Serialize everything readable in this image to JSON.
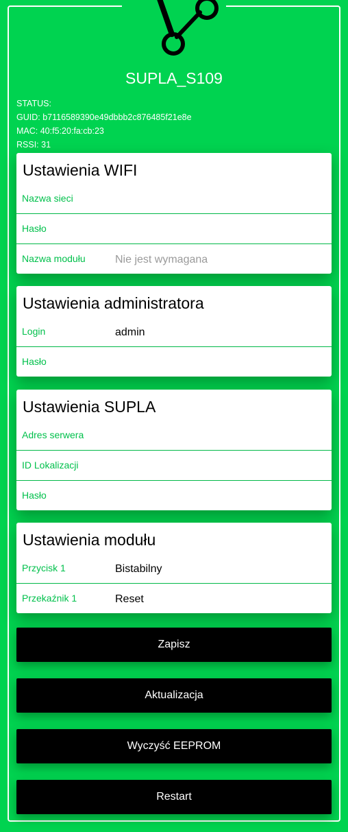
{
  "device_name": "SUPLA_S109",
  "status": {
    "status_line": "STATUS:",
    "guid_line": "GUID: b7116589390e49dbbb2c876485f21e8e",
    "mac_line": "MAC: 40:f5:20:fa:cb:23",
    "rssi_line": "RSSI: 31"
  },
  "wifi": {
    "title": "Ustawienia WIFI",
    "ssid_label": "Nazwa sieci",
    "ssid_value": "",
    "password_label": "Hasło",
    "password_value": "",
    "module_label": "Nazwa modułu",
    "module_placeholder": "Nie jest wymagana"
  },
  "admin": {
    "title": "Ustawienia administratora",
    "login_label": "Login",
    "login_value": "admin",
    "password_label": "Hasło",
    "password_value": ""
  },
  "supla": {
    "title": "Ustawienia SUPLA",
    "server_label": "Adres serwera",
    "server_value": "",
    "location_label": "ID Lokalizacji",
    "location_value": "",
    "password_label": "Hasło",
    "password_value": ""
  },
  "module": {
    "title": "Ustawienia modułu",
    "button_label": "Przycisk 1",
    "button_value": "Bistabilny",
    "relay_label": "Przekaźnik 1",
    "relay_value": "Reset"
  },
  "buttons": {
    "save": "Zapisz",
    "update": "Aktualizacja",
    "clear_eeprom": "Wyczyść EEPROM",
    "restart": "Restart"
  },
  "colors": {
    "background": "#00d350",
    "accent_label": "#00c04b",
    "button": "#000000"
  },
  "icons": {
    "logo": "supla-logo-icon"
  }
}
